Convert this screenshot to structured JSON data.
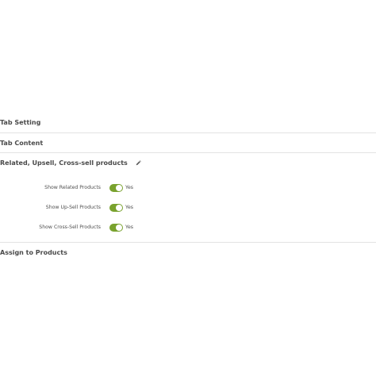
{
  "sections": {
    "tab_setting": "Tab Setting",
    "tab_content": "Tab Content",
    "related_products": "Related, Upsell, Cross-sell products",
    "assign_products": "Assign to Products"
  },
  "options": [
    {
      "label": "Show Related Products",
      "value": "Yes",
      "enabled": true
    },
    {
      "label": "Show Up-Sell Products",
      "value": "Yes",
      "enabled": true
    },
    {
      "label": "Show Cross-Sell Products",
      "value": "Yes",
      "enabled": true
    }
  ],
  "icons": {
    "edit": "pencil-icon"
  },
  "colors": {
    "toggle_on": "#79a22e"
  }
}
